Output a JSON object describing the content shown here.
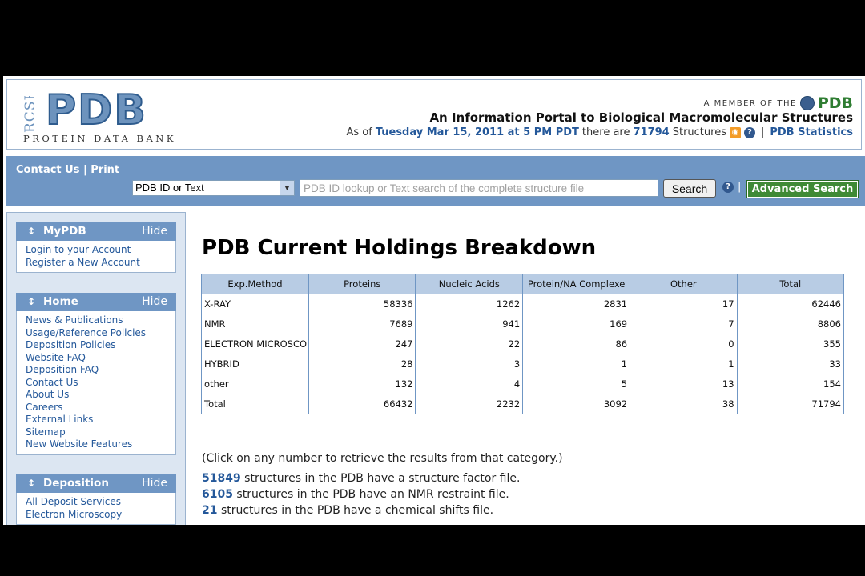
{
  "logo": {
    "rcsb": "RCSB",
    "pdb": "PDB",
    "subtitle": "PROTEIN DATA BANK"
  },
  "header": {
    "member_text": "A MEMBER OF THE",
    "member_org": "PDB",
    "portal_title": "An Information Portal to Biological Macromolecular Structures",
    "status_prefix": "As of",
    "status_date": "Tuesday Mar 15, 2011 at 5 PM PDT",
    "status_mid": "there are",
    "status_count": "71794",
    "status_suffix": "Structures",
    "rss_icon": "rss-icon",
    "help_icon": "question-icon",
    "stats_link": "PDB Statistics"
  },
  "nav": {
    "contact": "Contact Us",
    "separator": "|",
    "print": "Print",
    "search_type": "PDB ID or Text",
    "search_placeholder": "PDB ID lookup or Text search of the complete structure file",
    "search_button": "Search",
    "advanced_search": "Advanced Search"
  },
  "sidebar": {
    "hide_label": "Hide",
    "panels": [
      {
        "title": "MyPDB",
        "items": [
          "Login to your Account",
          "Register a New Account"
        ]
      },
      {
        "title": "Home",
        "items": [
          "News & Publications",
          "Usage/Reference Policies",
          "Deposition Policies",
          "Website FAQ",
          "Deposition FAQ",
          "Contact Us",
          "About Us",
          "Careers",
          "External Links",
          "Sitemap",
          "New Website Features"
        ]
      },
      {
        "title": "Deposition",
        "items": [
          "All Deposit Services",
          "Electron Microscopy"
        ]
      }
    ]
  },
  "main": {
    "title": "PDB Current Holdings Breakdown",
    "table": {
      "headers": [
        "Exp.Method",
        "Proteins",
        "Nucleic Acids",
        "Protein/NA Complexe",
        "Other",
        "Total"
      ],
      "rows": [
        [
          "X-RAY",
          "58336",
          "1262",
          "2831",
          "17",
          "62446"
        ],
        [
          "NMR",
          "7689",
          "941",
          "169",
          "7",
          "8806"
        ],
        [
          "ELECTRON MICROSCOPY",
          "247",
          "22",
          "86",
          "0",
          "355"
        ],
        [
          "HYBRID",
          "28",
          "3",
          "1",
          "1",
          "33"
        ],
        [
          "other",
          "132",
          "4",
          "5",
          "13",
          "154"
        ],
        [
          "Total",
          "66432",
          "2232",
          "3092",
          "38",
          "71794"
        ]
      ]
    },
    "note": "(Click on any number to retrieve the results from that category.)",
    "stats": [
      {
        "count": "51849",
        "text": "structures in the PDB have a structure factor file."
      },
      {
        "count": "6105",
        "text": "structures in the PDB have an NMR restraint file."
      },
      {
        "count": "21",
        "text": "structures in the PDB have a chemical shifts file."
      }
    ]
  }
}
